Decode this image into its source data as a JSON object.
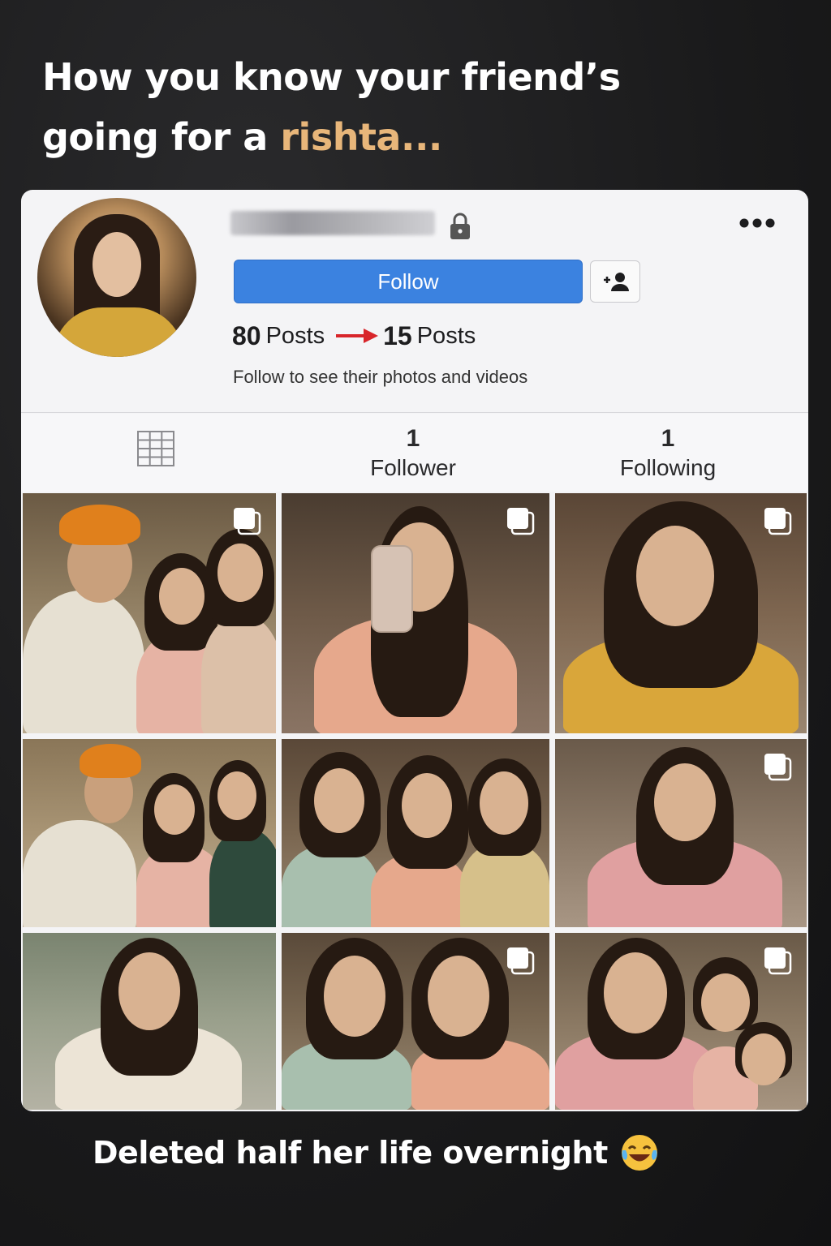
{
  "headline": {
    "line1": "How you know your friend’s",
    "line2_prefix": "going for a ",
    "line2_accent": "rishta..."
  },
  "profile": {
    "follow_label": "Follow",
    "posts_before_num": "80",
    "posts_before_lbl": "Posts",
    "posts_after_num": "15",
    "posts_after_lbl": "Posts",
    "private_note": "Follow to see their photos and videos"
  },
  "stats": {
    "followers_num": "1",
    "followers_lbl": "Follower",
    "following_num": "1",
    "following_lbl": "Following"
  },
  "caption": {
    "text": "Deleted half her life overnight"
  },
  "colors": {
    "accent": "#e8b67a",
    "follow_blue": "#3b82e0",
    "arrow_red": "#d8252a"
  },
  "icons": [
    "lock-icon",
    "more-icon",
    "add-user-icon",
    "grid-icon",
    "multi-photo-icon",
    "laughing-emoji-icon"
  ]
}
